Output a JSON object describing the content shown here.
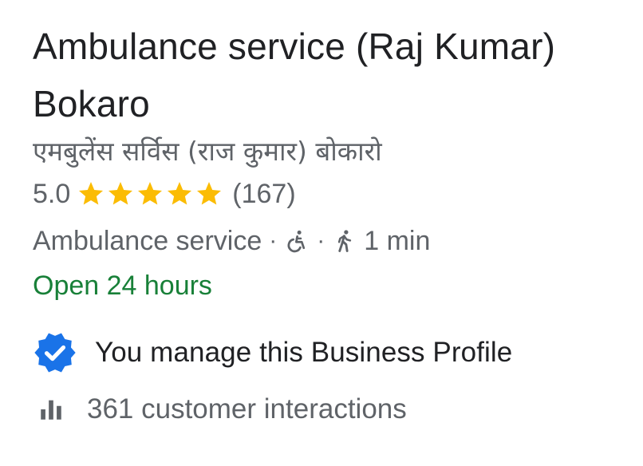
{
  "business": {
    "name_line1": "Ambulance service (Raj Kumar)",
    "name_line2": "Bokaro",
    "local_name": "एमबुलेंस सर्विस (राज कुमार) बोकारो",
    "rating": "5.0",
    "rating_stars": 5,
    "review_count": "(167)",
    "category": "Ambulance service",
    "separator": "·",
    "walk_time": "1 min",
    "hours_status": "Open 24 hours"
  },
  "profile": {
    "manage_text": "You manage this Business Profile",
    "interactions_text": "361 customer interactions"
  },
  "icons": {
    "star": "star-icon",
    "accessible": "wheelchair-icon",
    "walk": "walking-person-icon",
    "verified": "verified-badge-icon",
    "insights": "bar-chart-icon"
  },
  "colors": {
    "star": "#fbbc04",
    "open": "#188038",
    "verified": "#1a73e8",
    "text_primary": "#202124",
    "text_secondary": "#5f6368"
  }
}
